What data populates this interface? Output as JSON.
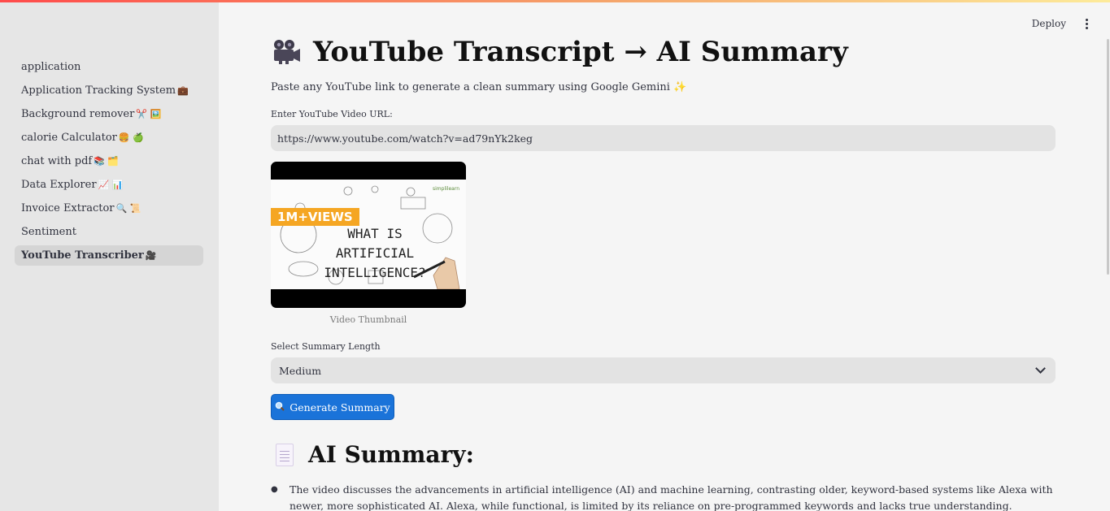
{
  "header": {
    "deploy_label": "Deploy"
  },
  "sidebar": {
    "items": [
      {
        "label": "application",
        "emoji": ""
      },
      {
        "label": "Application Tracking System",
        "emoji": "💼"
      },
      {
        "label": "Background remover",
        "emoji": "✂️ 🖼️"
      },
      {
        "label": "calorie Calculator",
        "emoji": "🍔 🍏"
      },
      {
        "label": "chat with pdf",
        "emoji": "📚 🗂️"
      },
      {
        "label": "Data Explorer",
        "emoji": "📈 📊"
      },
      {
        "label": "Invoice Extractor",
        "emoji": "🔍 📜"
      },
      {
        "label": "Sentiment",
        "emoji": ""
      },
      {
        "label": "YouTube Transcriber",
        "emoji": "🎥",
        "active": true
      }
    ]
  },
  "main": {
    "title": "YouTube Transcript → AI Summary",
    "subtitle": "Paste any YouTube link to generate a clean summary using Google Gemini ✨",
    "url_label": "Enter YouTube Video URL:",
    "url_value": "https://www.youtube.com/watch?v=ad79nYk2keg",
    "thumbnail": {
      "badge": "1M+VIEWS",
      "text_lines": [
        "WHAT IS",
        "ARTIFICIAL",
        "INTELLIGENCE?"
      ],
      "logo": "simplilearn",
      "caption": "Video Thumbnail"
    },
    "length_label": "Select Summary Length",
    "length_value": "Medium",
    "generate_button": "Generate Summary",
    "summary_heading": "AI Summary:",
    "summary_bullets": [
      "The video discusses the advancements in artificial intelligence (AI) and machine learning, contrasting older, keyword-based systems like Alexa with newer, more sophisticated AI. Alexa, while functional, is limited by its reliance on pre-programmed keywords and lacks true understanding."
    ]
  },
  "colors": {
    "primary_button": "#1a73d9",
    "sidebar_bg": "#e6e6e6",
    "main_bg": "#f5f5f5"
  }
}
